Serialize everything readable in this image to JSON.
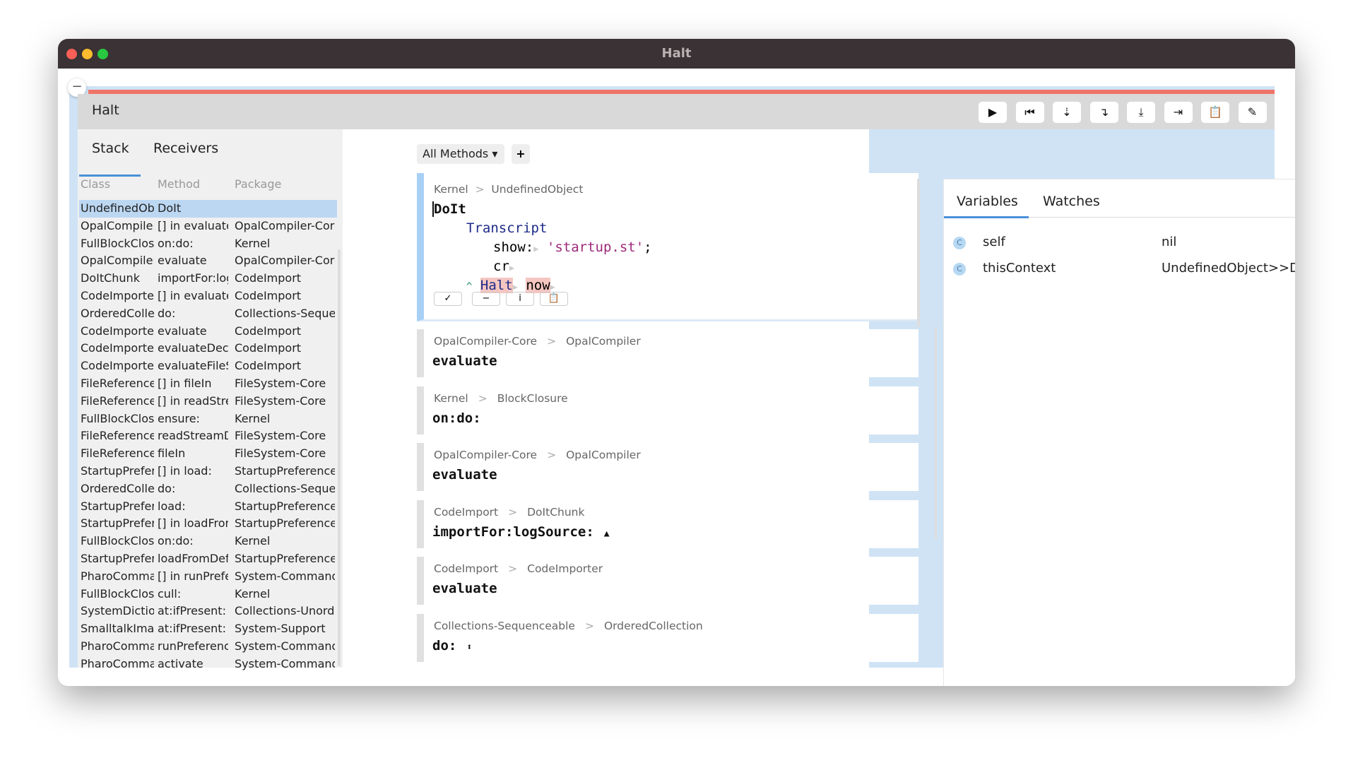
{
  "window": {
    "title": "Halt",
    "header_title": "Halt"
  },
  "toolbar": [
    {
      "name": "proceed",
      "glyph": "▶"
    },
    {
      "name": "restart",
      "glyph": "⏮"
    },
    {
      "name": "into",
      "glyph": "⇣"
    },
    {
      "name": "over",
      "glyph": "↴"
    },
    {
      "name": "through",
      "glyph": "⤓"
    },
    {
      "name": "run-to",
      "glyph": "⇥"
    },
    {
      "name": "copy-stack",
      "glyph": "📋"
    },
    {
      "name": "edit",
      "glyph": "✎"
    }
  ],
  "left": {
    "tabs": [
      "Stack",
      "Receivers"
    ],
    "columns": [
      "Class",
      "Method",
      "Package"
    ],
    "rows": [
      [
        "UndefinedObject",
        "DoIt",
        ""
      ],
      [
        "OpalCompiler",
        "[] in evaluate",
        "OpalCompiler-Core"
      ],
      [
        "FullBlockClosure",
        "on:do:",
        "Kernel"
      ],
      [
        "OpalCompiler",
        "evaluate",
        "OpalCompiler-Core"
      ],
      [
        "DoItChunk",
        "importFor:logSource:",
        "CodeImport"
      ],
      [
        "CodeImporter",
        "[] in evaluate",
        "CodeImport"
      ],
      [
        "OrderedCollection",
        "do:",
        "Collections-Sequenceable"
      ],
      [
        "CodeImporter",
        "evaluate",
        "CodeImport"
      ],
      [
        "CodeImporter",
        "evaluateDeclarations",
        "CodeImport"
      ],
      [
        "CodeImporter",
        "evaluateFileStream",
        "CodeImport"
      ],
      [
        "FileReference",
        "[] in fileIn",
        "FileSystem-Core"
      ],
      [
        "FileReference",
        "[] in readStreamDo:",
        "FileSystem-Core"
      ],
      [
        "FullBlockClosure",
        "ensure:",
        "Kernel"
      ],
      [
        "FileReference",
        "readStreamDo:",
        "FileSystem-Core"
      ],
      [
        "FileReference",
        "fileIn",
        "FileSystem-Core"
      ],
      [
        "StartupPreferencesLoader",
        "[] in load:",
        "StartupPreferences"
      ],
      [
        "OrderedCollection",
        "do:",
        "Collections-Sequenceable"
      ],
      [
        "StartupPreferencesLoader",
        "load:",
        "StartupPreferences"
      ],
      [
        "StartupPreferencesLoader",
        "[] in loadFromDefaultLocations",
        "StartupPreferences"
      ],
      [
        "FullBlockClosure",
        "on:do:",
        "Kernel"
      ],
      [
        "StartupPreferencesLoader",
        "loadFromDefaultLocations",
        "StartupPreferences"
      ],
      [
        "PharoCommandLineHandler",
        "[] in runPreferences",
        "System-CommandLine"
      ],
      [
        "FullBlockClosure",
        "cull:",
        "Kernel"
      ],
      [
        "SystemDictionary",
        "at:ifPresent:",
        "Collections-Unordered"
      ],
      [
        "SmalltalkImage",
        "at:ifPresent:",
        "System-Support"
      ],
      [
        "PharoCommandLineHandler",
        "runPreferences",
        "System-CommandLine"
      ],
      [
        "PharoCommandLineHandler",
        "activate",
        "System-CommandLine"
      ]
    ]
  },
  "middle": {
    "filter": "All Methods",
    "add": "+",
    "current": {
      "package": "Kernel",
      "sep": ">",
      "class": "UndefinedObject",
      "method": "DoIt",
      "code": {
        "l1": "Transcript",
        "l2a": "show:",
        "l2b": "'startup.st'",
        "l2c": ";",
        "l3a": "cr",
        ".": ".",
        "l4a": "^",
        "l4b": "Halt",
        "l4c": "now"
      },
      "buttons": [
        "✓",
        "−",
        "i",
        "📋"
      ]
    },
    "frames": [
      {
        "package": "OpalCompiler-Core",
        "class": "OpalCompiler",
        "method": "evaluate",
        "marker": ""
      },
      {
        "package": "Kernel",
        "class": "BlockClosure",
        "method": "on:do:",
        "marker": ""
      },
      {
        "package": "OpalCompiler-Core",
        "class": "OpalCompiler",
        "method": "evaluate",
        "marker": ""
      },
      {
        "package": "CodeImport",
        "class": "DoItChunk",
        "method": "importFor:logSource:",
        "marker": "▲"
      },
      {
        "package": "CodeImport",
        "class": "CodeImporter",
        "method": "evaluate",
        "marker": ""
      },
      {
        "package": "Collections-Sequenceable",
        "class": "OrderedCollection",
        "method": "do:",
        "marker": "⬍"
      }
    ]
  },
  "right": {
    "tabs": [
      "Variables",
      "Watches"
    ],
    "variables": [
      {
        "name": "self",
        "value": "nil"
      },
      {
        "name": "thisContext",
        "value": "UndefinedObject>>DoIt"
      }
    ]
  }
}
